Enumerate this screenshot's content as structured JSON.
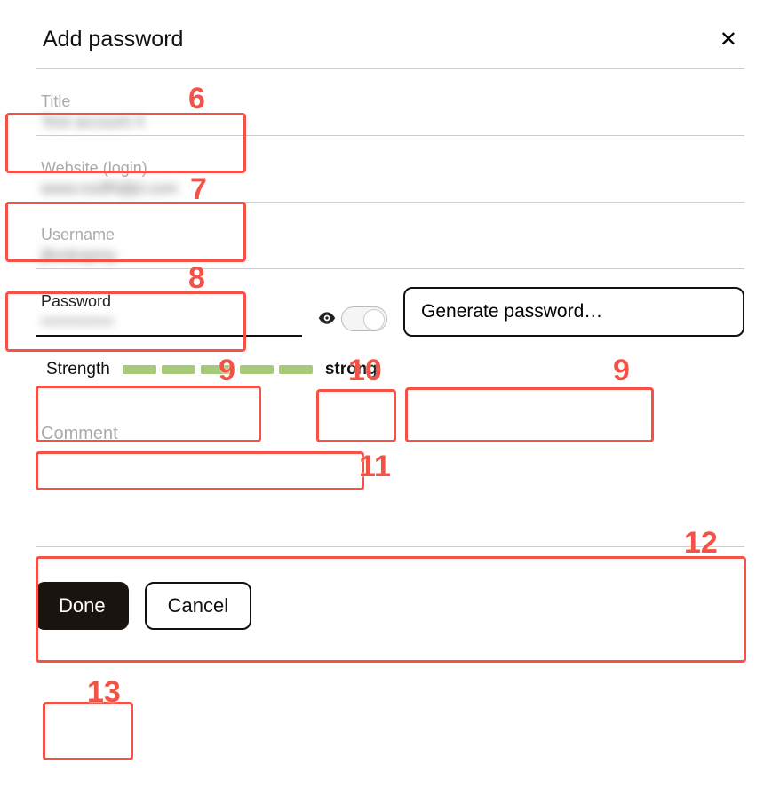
{
  "dialog": {
    "title": "Add password",
    "close_icon": "✕"
  },
  "fields": {
    "title": {
      "label": "Title",
      "value": "Test account 4"
    },
    "website": {
      "label": "Website (login)",
      "value": "www.nodfhljfjd.com"
    },
    "username": {
      "label": "Username",
      "value": "jlkmkopmy"
    },
    "password": {
      "label": "Password",
      "value": "•••••••••••••"
    },
    "comment": {
      "label": "Comment",
      "value": ""
    }
  },
  "password_controls": {
    "eye_icon": "👁",
    "generate_button": "Generate password…"
  },
  "strength": {
    "label": "Strength",
    "level": "strong",
    "bars_filled": 5,
    "bars_total": 5
  },
  "actions": {
    "done": "Done",
    "cancel": "Cancel"
  },
  "annotations": {
    "6": "6",
    "7": "7",
    "8": "8",
    "9": "9",
    "10": "10",
    "11": "11",
    "12": "12",
    "13": "13"
  }
}
